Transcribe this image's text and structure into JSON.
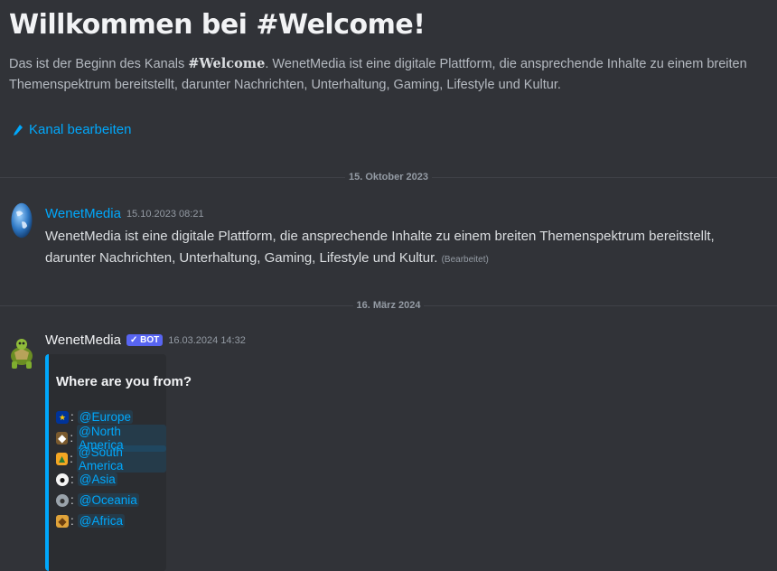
{
  "welcome": {
    "title": "Willkommen bei #Welcome!",
    "desc_prefix": "Das ist der Beginn des Kanals ",
    "channel": "#Welcome",
    "desc_suffix": ". WenetMedia ist eine digitale Plattform, die ansprechende Inhalte zu einem breiten Themenspektrum bereitstellt, darunter Nachrichten, Unterhaltung, Gaming, Lifestyle und Kultur.",
    "edit_label": "Kanal bearbeiten"
  },
  "dividers": [
    "15. Oktober 2023",
    "16. März 2024"
  ],
  "messages": [
    {
      "author": "WenetMedia",
      "timestamp": "15.10.2023 08:21",
      "text": "WenetMedia ist eine digitale Plattform, die ansprechende Inhalte zu einem breiten Themenspektrum bereitstellt, darunter Nachrichten, Unterhaltung, Gaming, Lifestyle und Kultur.",
      "edited": "(Bearbeitet)",
      "author_color": "#00a8fc"
    },
    {
      "author": "WenetMedia",
      "badge": "✓ BOT",
      "timestamp": "16.03.2024 14:32",
      "author_color": "#f2f3f5",
      "embed": {
        "title": "Where are you from?",
        "separator": ":",
        "roles": [
          {
            "emoji": "eu-flag-icon",
            "label": "@Europe"
          },
          {
            "emoji": "eagle-icon",
            "label": "@North America"
          },
          {
            "emoji": "south-america-icon",
            "label": "@South America"
          },
          {
            "emoji": "panda-icon",
            "label": "@Asia"
          },
          {
            "emoji": "koala-icon",
            "label": "@Oceania"
          },
          {
            "emoji": "giraffe-icon",
            "label": "@Africa"
          }
        ]
      }
    }
  ],
  "colors": {
    "background": "#313338",
    "link": "#00a8fc",
    "bot_badge": "#5865f2",
    "embed_bar": "#00a8fc"
  }
}
